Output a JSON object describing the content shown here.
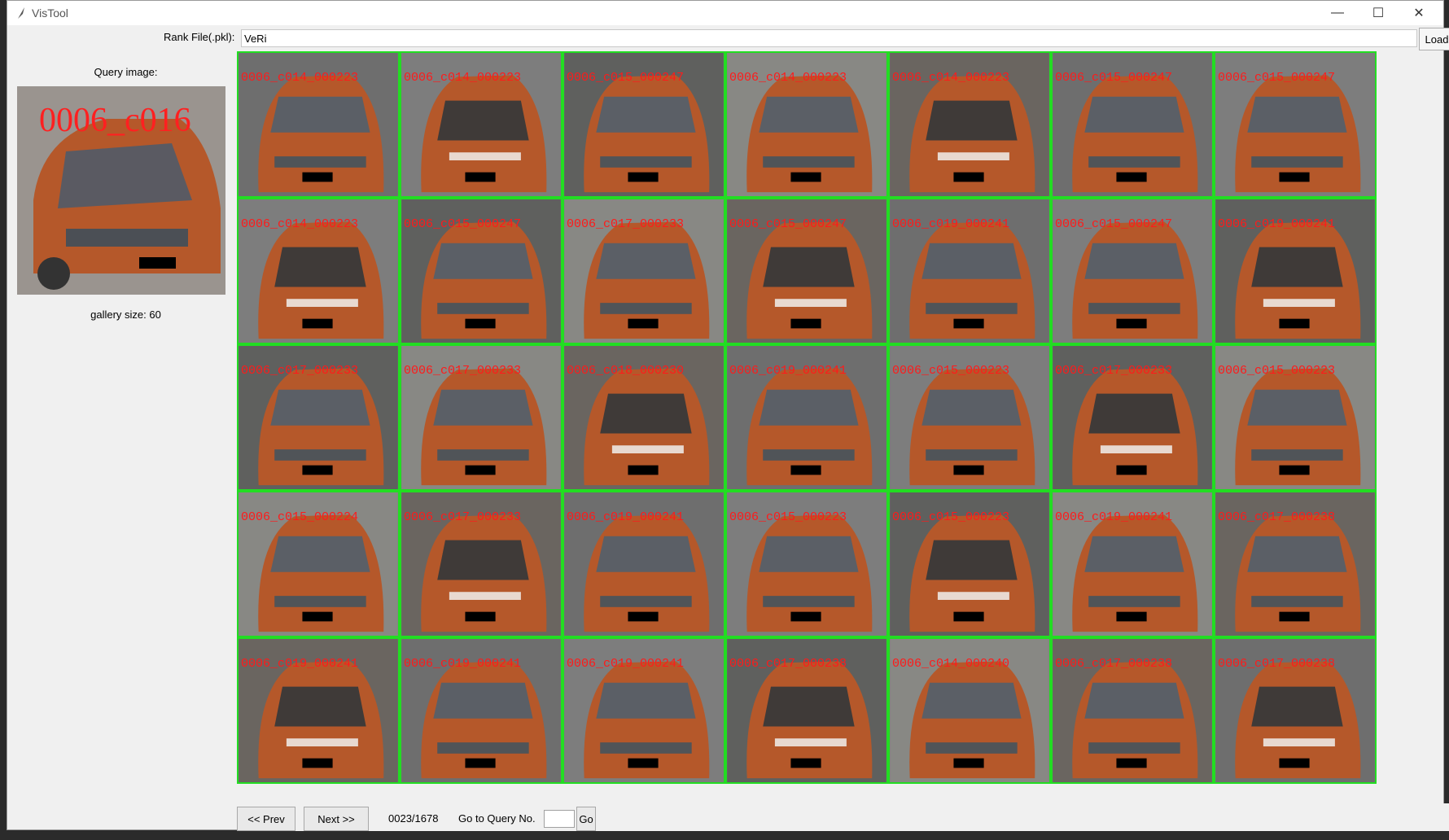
{
  "window": {
    "title": "VisTool",
    "minimize_glyph": "—",
    "maximize_glyph": "☐",
    "close_glyph": "✕"
  },
  "toolbar": {
    "rank_file_label": "Rank File(.pkl):",
    "rank_file_value": "VeRi",
    "load_label": "Load"
  },
  "query": {
    "label": "Query image:",
    "image_text": "0006_c016",
    "gallery_size_label": "gallery size: 60"
  },
  "gallery": [
    [
      "0006_c014_000223",
      "0006_c014_000223",
      "0006_c015_000247",
      "0006_c014_000223",
      "0006_c014_000223",
      "0006_c015_000247",
      "0006_c015_000247"
    ],
    [
      "0006_c014_000223",
      "0006_c015_000247",
      "0006_c017_000233",
      "0006_c015_000247",
      "0006_c019_000241",
      "0006_c015_000247",
      "0006_c019_000241"
    ],
    [
      "0006_c017_000233",
      "0006_c017_000233",
      "0006_c018_000230",
      "0006_c019_000241",
      "0006_c015_000223",
      "0006_c017_000233",
      "0006_c015_000223"
    ],
    [
      "0006_c015_000224",
      "0006_c017_000233",
      "0006_c019_000241",
      "0006_c015_000223",
      "0006_c015_000223",
      "0006_c019_000241",
      "0006_c017_000238"
    ],
    [
      "0006_c019_000241",
      "0006_c019_000241",
      "0006_c019_000241",
      "0006_c017_000238",
      "0006_c014_000240",
      "0006_c017_000238",
      "0006_c017_000238"
    ]
  ],
  "nav": {
    "prev_label": "<< Prev",
    "next_label": "Next >>",
    "counter": "0023/1678",
    "goto_label": "Go to Query No.",
    "go_label": "Go"
  },
  "colors": {
    "tile_border": "#22dd22",
    "label_text": "#ff1a1a",
    "car_body": "#b5582a"
  }
}
